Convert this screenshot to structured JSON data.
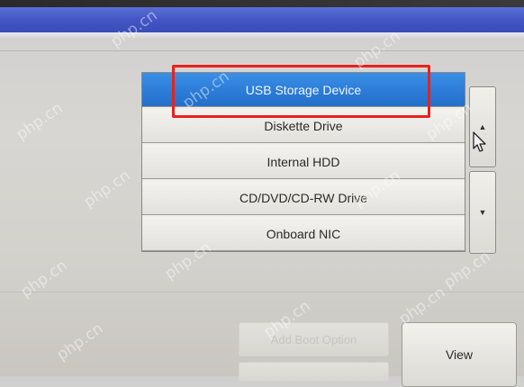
{
  "boot_list": {
    "items": [
      {
        "label": "USB Storage Device",
        "selected": true
      },
      {
        "label": "Diskette Drive",
        "selected": false
      },
      {
        "label": "Internal HDD",
        "selected": false
      },
      {
        "label": "CD/DVD/CD-RW Drive",
        "selected": false
      },
      {
        "label": "Onboard NIC",
        "selected": false
      }
    ]
  },
  "scrollbar": {
    "up_glyph": "▲",
    "down_glyph": "▼"
  },
  "buttons": {
    "add_boot_option": "Add Boot Option",
    "view": "View"
  },
  "annotation": {
    "highlight_color": "#e8211c"
  },
  "watermark": {
    "text": "php.cn"
  },
  "colors": {
    "selected_item": "#2a7ad6",
    "title_bar": "#4356c4"
  }
}
